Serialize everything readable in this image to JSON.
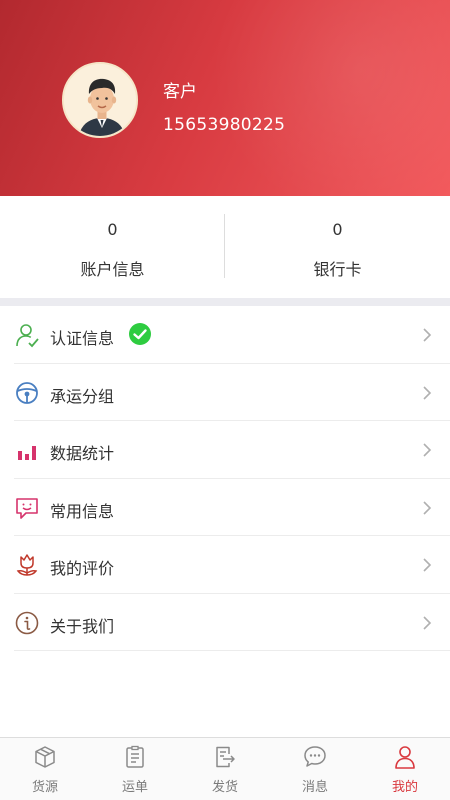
{
  "profile": {
    "name": "客户",
    "phone": "15653980225"
  },
  "stats": [
    {
      "value": "0",
      "label": "账户信息"
    },
    {
      "value": "0",
      "label": "银行卡"
    }
  ],
  "menu": {
    "items": [
      {
        "label": "认证信息",
        "icon": "user-check-icon",
        "verified": true
      },
      {
        "label": "承运分组",
        "icon": "steering-wheel-icon"
      },
      {
        "label": "数据统计",
        "icon": "bar-chart-icon"
      },
      {
        "label": "常用信息",
        "icon": "smile-message-icon"
      },
      {
        "label": "我的评价",
        "icon": "flower-icon"
      },
      {
        "label": "关于我们",
        "icon": "info-icon"
      }
    ]
  },
  "tabbar": {
    "active": "我的",
    "items": [
      {
        "label": "货源",
        "icon": "box-icon"
      },
      {
        "label": "运单",
        "icon": "clipboard-icon"
      },
      {
        "label": "发货",
        "icon": "send-document-icon"
      },
      {
        "label": "消息",
        "icon": "chat-icon"
      },
      {
        "label": "我的",
        "icon": "person-icon"
      }
    ]
  },
  "colors": {
    "header_start": "#b2292f",
    "header_end": "#f25a5d",
    "accent": "#d9393f",
    "verified": "#2ecc40"
  }
}
